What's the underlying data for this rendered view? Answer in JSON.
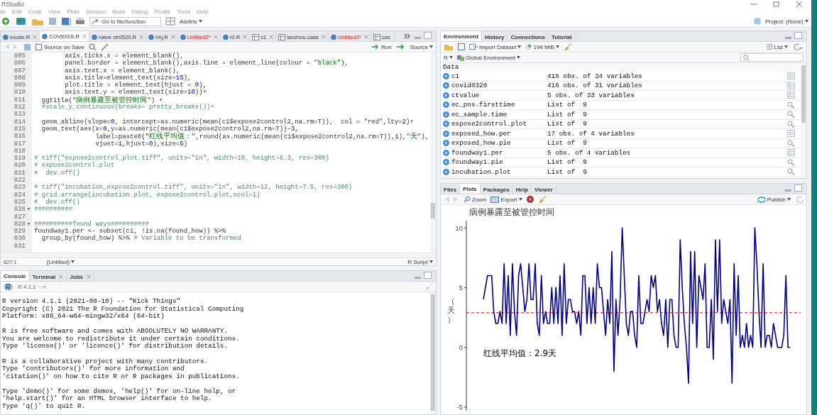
{
  "window": {
    "title": "RStudio"
  },
  "menu": [
    "ile",
    "Edit",
    "Code",
    "View",
    "Plots",
    "Session",
    "Build",
    "Debug",
    "Profile",
    "Tools",
    "Help"
  ],
  "toolbar": {
    "goto": {
      "placeholder": "Go to file/function"
    },
    "addins": "Addins",
    "project": "Project: (None)"
  },
  "editor": {
    "tabs": [
      {
        "label": "ecode.R",
        "kind": "script",
        "selected": false,
        "unsaved": false
      },
      {
        "label": "COVIDGS.R",
        "kind": "script",
        "selected": true,
        "unsaved": false
      },
      {
        "label": "naive ctr0520.R",
        "kind": "script",
        "selected": false,
        "unsaved": false
      },
      {
        "label": "hhj.R",
        "kind": "script",
        "selected": false,
        "unsaved": false
      },
      {
        "label": "Untitled2*",
        "kind": "script",
        "selected": false,
        "unsaved": true
      },
      {
        "label": "r0.R",
        "kind": "script",
        "selected": false,
        "unsaved": false
      },
      {
        "label": "c1",
        "kind": "data",
        "selected": false,
        "unsaved": false
      },
      {
        "label": "lanzhou.case",
        "kind": "data",
        "selected": false,
        "unsaved": false
      },
      {
        "label": "Untitled3*",
        "kind": "script",
        "selected": false,
        "unsaved": true
      },
      {
        "label": "cas",
        "kind": "data",
        "selected": false,
        "unsaved": false
      }
    ],
    "source_on_save": {
      "label": "Source on Save",
      "checked": false
    },
    "run": "Run",
    "source": "Source",
    "lines": [
      {
        "number": "805",
        "fold": false,
        "text": "        axis.ticks.x = element_blank(),"
      },
      {
        "number": "806",
        "fold": false,
        "text": "        panel.border = element_blank(),axis.line = element_line(colour = \"black\"),"
      },
      {
        "number": "807",
        "fold": false,
        "text": "        axis.text.x = element_blank(),"
      },
      {
        "number": "808",
        "fold": false,
        "text": "        axis.title=element_text(size=15),"
      },
      {
        "number": "809",
        "fold": false,
        "text": "        plot.title = element_text(hjust = 0),"
      },
      {
        "number": "810",
        "fold": false,
        "text": "        axis.text.y = element_text(size=10))+"
      },
      {
        "number": "811",
        "fold": false,
        "text": "  ggtitle(\"病例暴露至被管控时间\") +"
      },
      {
        "number": "812",
        "fold": false,
        "text": "  #scale_y_continuous(breaks= pretty_breaks())+"
      },
      {
        "number": "813",
        "fold": false
      },
      {
        "number": "814",
        "fold": false,
        "text": "  geom_abline(slope=0, intercept=as.numeric(mean(c1$expose2control2,na.rm=T)),  col = \"red\",lty=2)+"
      },
      {
        "number": "815",
        "fold": false,
        "text": "  geom_text(aes(x=0,y=as.numeric(mean(c1$expose2control2,na.rm=T))-3,"
      },
      {
        "number": "816",
        "fold": false,
        "text": "                label=paste0(\"红线平均值：\",round(as.numeric(mean(c1$expose2control2,na.rm=T)),1),\"天\"),"
      },
      {
        "number": "817",
        "fold": false,
        "text": "                vjust=1,hjust=0),size=5)"
      },
      {
        "number": "818",
        "fold": false
      },
      {
        "number": "819",
        "fold": false,
        "text": "# tiff(\"expose2control_plot.tiff\", units=\"in\", width=10, height=6.3, res=300)"
      },
      {
        "number": "820",
        "fold": false,
        "text": "# expose2control.plot"
      },
      {
        "number": "821",
        "fold": false,
        "text": "#  dev.off()"
      },
      {
        "number": "822",
        "fold": false
      },
      {
        "number": "823",
        "fold": false,
        "text": "# tiff(\"incubation_expose2control.tiff\", units=\"in\", width=12, height=7.5, res=300)"
      },
      {
        "number": "824",
        "fold": false,
        "text": "# grid.arrange(incubation.plot, expose2control.plot,ncol=1)"
      },
      {
        "number": "825",
        "fold": false,
        "text": "#  dev.off()"
      },
      {
        "number": "826",
        "fold": true,
        "text": "##########"
      },
      {
        "number": "827",
        "fold": false
      },
      {
        "number": "828",
        "fold": true,
        "text": "##########found ways##########"
      },
      {
        "number": "829",
        "fold": false,
        "text": "foundway1.per <- subset(c1, !is.na(found_how)) %>%"
      },
      {
        "number": "830",
        "fold": false,
        "text": "  group_by(found_how) %>% # Variable to be transformed"
      },
      {
        "number": "831",
        "fold": false
      }
    ],
    "status": {
      "position": "827:1",
      "scope": "(Untitled)",
      "type": "R Script"
    }
  },
  "console": {
    "tabs": [
      {
        "label": "Console",
        "selected": true,
        "closable": false
      },
      {
        "label": "Terminal",
        "selected": false,
        "closable": true
      },
      {
        "label": "Jobs",
        "selected": false,
        "closable": true
      }
    ],
    "version": "R 4.1.1 · ~/",
    "paragraphs": [
      [
        "R version 4.1.1 (2021-08-10) -- \"Kick Things\"",
        "Copyright (C) 2021 The R Foundation for Statistical Computing",
        "Platform: x86_64-w64-mingw32/x64 (64-bit)"
      ],
      [
        "R is free software and comes with ABSOLUTELY NO WARRANTY.",
        "You are welcome to redistribute it under certain conditions.",
        "Type 'license()' or 'licence()' for distribution details."
      ],
      [
        "R is a collaborative project with many contributors.",
        "Type 'contributors()' for more information and",
        "'citation()' on how to cite R or R packages in publications."
      ],
      [
        "Type 'demo()' for some demos, 'help()' for on-line help, or",
        "'help.start()' for an HTML browser interface to help.",
        "Type 'q()' to quit R."
      ]
    ]
  },
  "environment": {
    "tabs": [
      {
        "label": "Environment",
        "selected": true
      },
      {
        "label": "History",
        "selected": false
      },
      {
        "label": "Connections",
        "selected": false
      },
      {
        "label": "Tutorial",
        "selected": false
      }
    ],
    "import": "Import Dataset",
    "memory": "194 MiB",
    "view": "List",
    "language": "R",
    "scope": "Global Environment",
    "section": "Data",
    "rows": [
      {
        "name": "c1",
        "value": "416 obs. of 34 variables",
        "kind": "table"
      },
      {
        "name": "covid0320",
        "value": "416 obs. of 31 variables",
        "kind": "table"
      },
      {
        "name": "ctvalue",
        "value": "5 obs. of 33 variables",
        "kind": "table"
      },
      {
        "name": "ec_pos.firsttime",
        "value": "List of  9",
        "kind": "list"
      },
      {
        "name": "ec_sample.time",
        "value": "List of  9",
        "kind": "list"
      },
      {
        "name": "expose2control.plot",
        "value": "List of  9",
        "kind": "list"
      },
      {
        "name": "exposed_how.per",
        "value": "17 obs. of 4 variables",
        "kind": "table"
      },
      {
        "name": "exposed_how.pie",
        "value": "List of  9",
        "kind": "list"
      },
      {
        "name": "foundway1.per",
        "value": "5 obs. of 4 variables",
        "kind": "table"
      },
      {
        "name": "foundway1.pie",
        "value": "List of  9",
        "kind": "list"
      },
      {
        "name": "incubation.plot",
        "value": "List of  9",
        "kind": "list"
      }
    ]
  },
  "plots": {
    "tabs": [
      {
        "label": "Files",
        "selected": false
      },
      {
        "label": "Plots",
        "selected": true
      },
      {
        "label": "Packages",
        "selected": false
      },
      {
        "label": "Help",
        "selected": false
      },
      {
        "label": "Viewer",
        "selected": false
      }
    ],
    "zoom": "Zoom",
    "export": "Export",
    "publish": "Publish",
    "chart_data": {
      "type": "line",
      "title": "病例暴露至被管控时间",
      "ylabel": "（天）",
      "ylim": [
        -5.3,
        10.6
      ],
      "yticks": [
        -5,
        0,
        5,
        10
      ],
      "series": [
        {
          "color": "#00008b",
          "values": [
            4,
            5,
            6,
            6,
            6,
            3,
            2,
            2,
            3,
            2,
            7,
            2,
            6,
            1,
            7,
            3,
            1,
            6,
            7,
            5,
            3,
            4,
            7,
            4,
            4,
            7,
            2,
            1,
            6,
            2,
            3,
            2,
            2,
            5,
            2,
            5,
            2,
            6,
            1,
            7,
            2,
            4,
            4,
            3,
            3,
            2,
            3,
            1,
            6,
            6,
            2,
            5,
            2,
            5,
            2,
            7,
            5,
            5,
            3,
            1,
            4,
            2,
            8,
            -2,
            4,
            1,
            4,
            10,
            6,
            2,
            1,
            3,
            3,
            1,
            0,
            6,
            2,
            2,
            3,
            4,
            3,
            6,
            5,
            6,
            3,
            4,
            2,
            1,
            4,
            0,
            4,
            4,
            1,
            0,
            0,
            9,
            5,
            2,
            0,
            -3,
            8,
            2,
            8,
            0,
            6,
            5,
            4,
            7,
            0,
            0,
            4,
            -1,
            9,
            3,
            9,
            2,
            4,
            3,
            2,
            4,
            -3,
            7,
            1,
            6,
            0,
            1,
            0,
            2,
            0,
            1,
            0,
            10,
            7,
            3,
            0,
            7,
            0,
            1,
            1,
            0,
            2,
            1,
            0,
            0,
            0,
            1,
            6,
            0,
            0
          ]
        }
      ],
      "ref_lines": [
        {
          "axis": "y",
          "value": 2.9
        }
      ],
      "annotations": [
        "红线平均值：2.9天"
      ]
    }
  }
}
